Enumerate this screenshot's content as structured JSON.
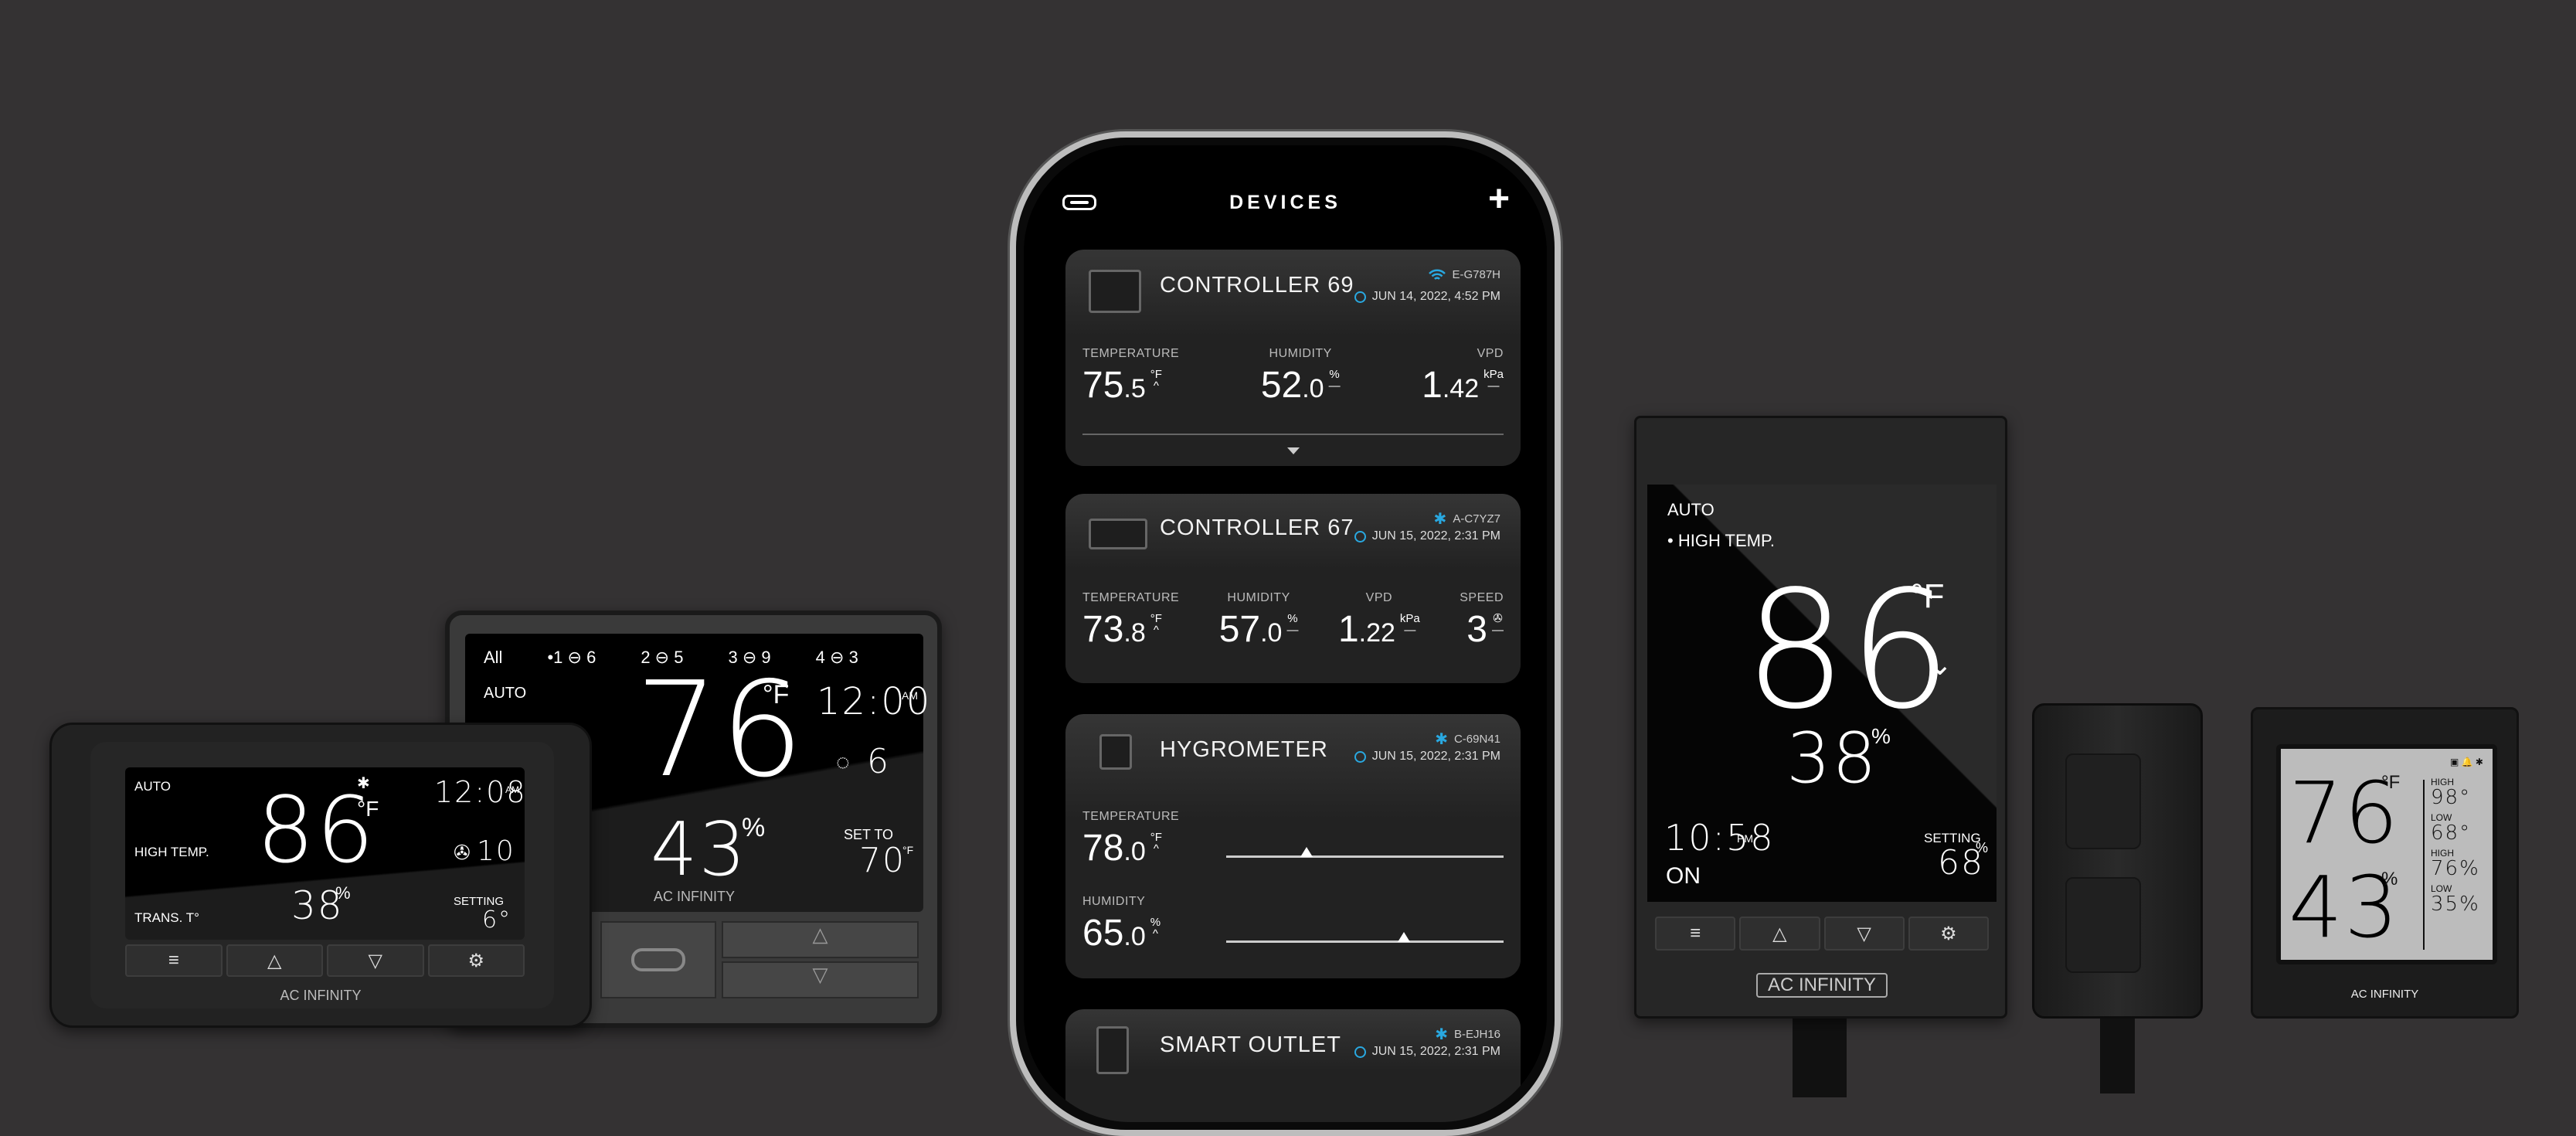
{
  "phone": {
    "title": "DEVICES",
    "menu_icon": "controller-link-icon",
    "add_icon": "plus-icon",
    "accent": "#29a8e0",
    "cards": [
      {
        "name": "CONTROLLER 69",
        "conn": "wifi",
        "id": "E-G787H",
        "date": "JUN 14, 2022, 4:52 PM",
        "readings": [
          {
            "label": "TEMPERATURE",
            "int": "75",
            "dec": ".5",
            "unit": "°F",
            "trend": "^"
          },
          {
            "label": "HUMIDITY",
            "int": "52",
            "dec": ".0",
            "unit": "%",
            "trend": "—"
          },
          {
            "label": "VPD",
            "int": "1",
            "dec": ".42",
            "unit": "kPa",
            "trend": "—"
          }
        ]
      },
      {
        "name": "CONTROLLER 67",
        "conn": "bluetooth",
        "id": "A-C7YZ7",
        "date": "JUN 15, 2022, 2:31 PM",
        "readings": [
          {
            "label": "TEMPERATURE",
            "int": "73",
            "dec": ".8",
            "unit": "°F",
            "trend": "^"
          },
          {
            "label": "HUMIDITY",
            "int": "57",
            "dec": ".0",
            "unit": "%",
            "trend": "—"
          },
          {
            "label": "VPD",
            "int": "1",
            "dec": ".22",
            "unit": "kPa",
            "trend": "—"
          },
          {
            "label": "SPEED",
            "int": "3",
            "dec": "",
            "unit": "fan",
            "trend": "—"
          }
        ]
      },
      {
        "name": "HYGROMETER",
        "conn": "bluetooth",
        "id": "C-69N41",
        "date": "JUN 15, 2022, 2:31 PM",
        "readings": [
          {
            "label": "TEMPERATURE",
            "int": "78",
            "dec": ".0",
            "unit": "°F",
            "trend": "^",
            "slider": 0.29
          },
          {
            "label": "HUMIDITY",
            "int": "65",
            "dec": ".0",
            "unit": "%",
            "trend": "^",
            "slider": 0.64
          }
        ]
      },
      {
        "name": "SMART OUTLET",
        "conn": "bluetooth",
        "id": "B-EJH16",
        "date": "JUN 15, 2022, 2:31 PM"
      }
    ]
  },
  "controller_small": {
    "mode": "AUTO",
    "status": "HIGH TEMP.",
    "sensor": "TRANS. T°",
    "temp": "86",
    "temp_unit": "°F",
    "time": "12:08",
    "ampm": "AM",
    "fan": "10",
    "humidity": "38",
    "hum_unit": "%",
    "setting_label": "SETTING",
    "setting": "6°",
    "buttons": [
      "≡",
      "△",
      "▽",
      "⚙"
    ],
    "brand": "AC INFINITY"
  },
  "controller_large": {
    "all": "All",
    "ports": [
      {
        "n": "•1",
        "v": "6"
      },
      {
        "n": "2",
        "v": "5"
      },
      {
        "n": "3",
        "v": "9"
      },
      {
        "n": "4",
        "v": "3"
      }
    ],
    "mode": "AUTO",
    "temp": "76",
    "temp_unit": "°F",
    "time": "12:00",
    "ampm": "AM",
    "level": "6",
    "humidity": "43",
    "hum_unit": "%",
    "set_label": "SET TO",
    "set_value": "70",
    "set_unit": "°F",
    "brand": "AC INFINITY",
    "buttons": [
      "△",
      "▽"
    ]
  },
  "controller_vertical": {
    "mode": "AUTO",
    "status": "HIGH TEMP.",
    "temp": "86",
    "temp_unit": "°F",
    "humidity": "38",
    "hum_unit": "%",
    "time": "10:58",
    "ampm": "PM",
    "state": "ON",
    "setting_label": "SETTING",
    "setting": "68",
    "setting_unit": "%",
    "buttons": [
      "≡",
      "△",
      "▽",
      "⚙"
    ],
    "brand": "AC INFINITY"
  },
  "hygrometer": {
    "temp": "76",
    "temp_unit": "°F",
    "humidity": "43",
    "hum_unit": "%",
    "stats": [
      {
        "label": "HIGH",
        "value": "98°"
      },
      {
        "label": "LOW",
        "value": "68°"
      },
      {
        "label": "HIGH",
        "value": "76%"
      },
      {
        "label": "LOW",
        "value": "35%"
      }
    ],
    "brand": "AC INFINITY"
  }
}
